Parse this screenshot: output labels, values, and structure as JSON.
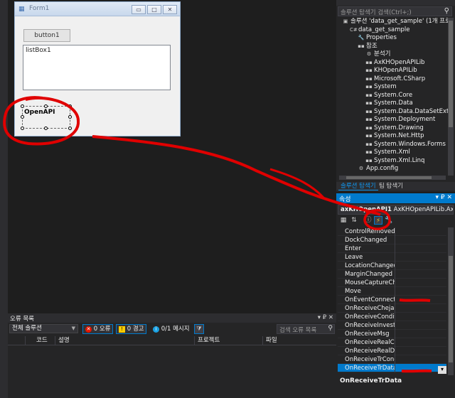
{
  "form": {
    "title": "Form1",
    "icon": "form-icon",
    "button1_label": "button1",
    "listbox_text": "listBox1",
    "control_label": "OpenAPI",
    "minimize": "▭",
    "maximize": "□",
    "close": "✕"
  },
  "solution_explorer": {
    "search_placeholder": "솔루션 탐색기 검색(Ctrl+;)",
    "search_icon": "search-icon",
    "items": [
      {
        "indent": 0,
        "icon": "▣",
        "label": "솔루션 'data_get_sample' (1개 프로젝트)"
      },
      {
        "indent": 1,
        "icon": "C#",
        "label": "data_get_sample"
      },
      {
        "indent": 2,
        "icon": "🔧",
        "label": "Properties"
      },
      {
        "indent": 2,
        "icon": "▪▪",
        "label": "참조"
      },
      {
        "indent": 3,
        "icon": "⚙",
        "label": "분석기"
      },
      {
        "indent": 3,
        "icon": "▪▪",
        "label": "AxKHOpenAPILib"
      },
      {
        "indent": 3,
        "icon": "▪▪",
        "label": "KHOpenAPILib"
      },
      {
        "indent": 3,
        "icon": "▪▪",
        "label": "Microsoft.CSharp"
      },
      {
        "indent": 3,
        "icon": "▪▪",
        "label": "System"
      },
      {
        "indent": 3,
        "icon": "▪▪",
        "label": "System.Core"
      },
      {
        "indent": 3,
        "icon": "▪▪",
        "label": "System.Data"
      },
      {
        "indent": 3,
        "icon": "▪▪",
        "label": "System.Data.DataSetExtensions"
      },
      {
        "indent": 3,
        "icon": "▪▪",
        "label": "System.Deployment"
      },
      {
        "indent": 3,
        "icon": "▪▪",
        "label": "System.Drawing"
      },
      {
        "indent": 3,
        "icon": "▪▪",
        "label": "System.Net.Http"
      },
      {
        "indent": 3,
        "icon": "▪▪",
        "label": "System.Windows.Forms"
      },
      {
        "indent": 3,
        "icon": "▪▪",
        "label": "System.Xml"
      },
      {
        "indent": 3,
        "icon": "▪▪",
        "label": "System.Xml.Linq"
      },
      {
        "indent": 2,
        "icon": "⚙",
        "label": "App.config"
      }
    ],
    "tabs": {
      "solution": "솔루션 탐색기",
      "team": "팀 탐색기"
    }
  },
  "properties": {
    "title": "속성",
    "header_icons": "▾ ₽ ✕",
    "object_name": "axKHOpenAPI1",
    "object_type": " AxKHOpenAPILib.AxKHOpe",
    "toolbar": [
      "▦",
      "⇅",
      "ⓘ",
      "⚡",
      "🔧"
    ],
    "rows": [
      "ControlRemoved",
      "DockChanged",
      "Enter",
      "Leave",
      "LocationChanged",
      "MarginChanged",
      "MouseCaptureChanged",
      "Move",
      "OnEventConnect",
      "OnReceiveChejanData",
      "OnReceiveConditionVer",
      "OnReceiveInvestRealData",
      "OnReceiveMsg",
      "OnReceiveRealCondition",
      "OnReceiveRealData",
      "OnReceiveTrCondition",
      "OnReceiveTrData"
    ],
    "selected_index": 16,
    "description_name": "OnReceiveTrData",
    "dropdown_arrow": "▾"
  },
  "error_list": {
    "title": "오류 목록",
    "header_icons": "▾ ₽ ✕",
    "scope": "전체 솔루션",
    "errors_label": "0 오류",
    "warnings_label": "0 경고",
    "messages_label": "0/1 메시지",
    "search_placeholder": "검색 오류 목록",
    "columns": [
      "",
      "코드",
      "설명",
      "프로젝트",
      "파일"
    ]
  },
  "colors": {
    "accent": "#007acc",
    "annotation": "#e00000"
  }
}
